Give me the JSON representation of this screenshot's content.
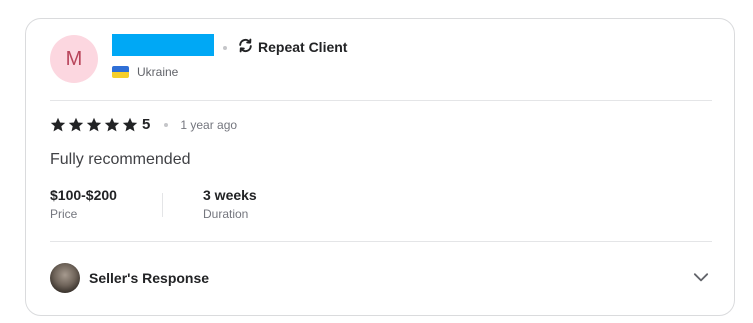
{
  "review": {
    "avatar_initial": "M",
    "repeat_label": "Repeat Client",
    "country": "Ukraine",
    "rating": "5",
    "time_ago": "1 year ago",
    "text": "Fully recommended",
    "price_value": "$100-$200",
    "price_label": "Price",
    "duration_value": "3 weeks",
    "duration_label": "Duration",
    "seller_response_label": "Seller's Response",
    "stars_filled": 5,
    "stars_total": 5
  },
  "colors": {
    "avatar_bg": "#fcd7e0",
    "avatar_text": "#b8455b",
    "redaction": "#00a8f5",
    "flag_top": "#2f6fd6",
    "flag_bottom": "#f6cf2a",
    "star": "#222325"
  },
  "icons": {
    "repeat": "repeat-icon",
    "flag": "ukraine-flag-icon",
    "star": "star-icon",
    "chevron": "chevron-down-icon"
  }
}
